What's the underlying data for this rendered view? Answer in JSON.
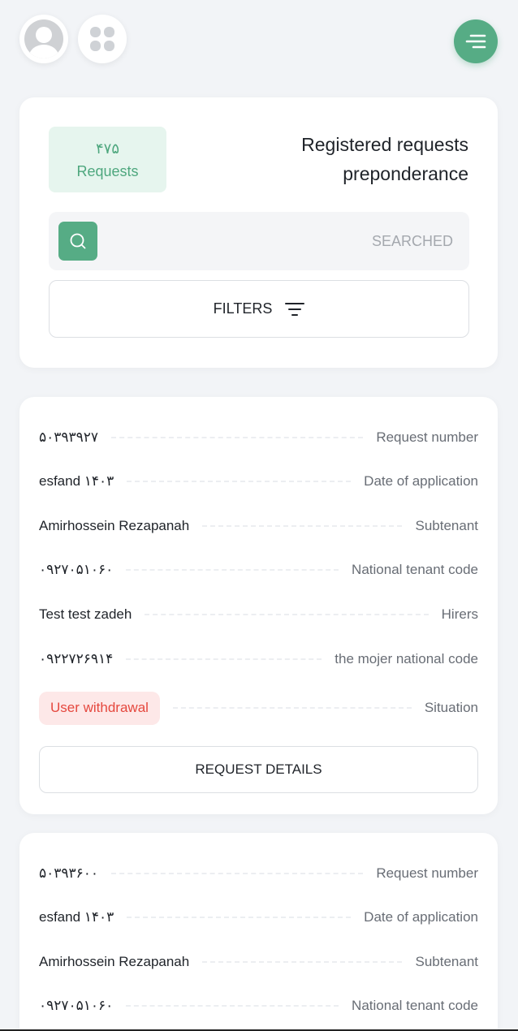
{
  "summary": {
    "count": "۴۷۵",
    "count_unit": "Requests",
    "title": "Registered requests preponderance",
    "search_placeholder": "SEARCHED",
    "filters_label": "FILTERS"
  },
  "requests": [
    {
      "rows": [
        {
          "label": "Request number",
          "value": "۵۰۳۹۳۹۲۷"
        },
        {
          "label": "Date of application",
          "value": "esfand ۱۴۰۳"
        },
        {
          "label": "Subtenant",
          "value": "Amirhossein Rezapanah"
        },
        {
          "label": "National tenant code",
          "value": "۰۹۲۷۰۵۱۰۶۰"
        },
        {
          "label": "Hirers",
          "value": "Test test zadeh"
        },
        {
          "label": "the mojer national code",
          "value": "۰۹۲۲۷۲۶۹۱۴"
        },
        {
          "label": "Situation",
          "value": "User withdrawal"
        }
      ],
      "details_label": "REQUEST DETAILS"
    },
    {
      "rows": [
        {
          "label": "Request number",
          "value": "۵۰۳۹۳۶۰۰"
        },
        {
          "label": "Date of application",
          "value": "esfand ۱۴۰۳"
        },
        {
          "label": "Subtenant",
          "value": "Amirhossein Rezapanah"
        },
        {
          "label": "National tenant code",
          "value": "۰۹۲۷۰۵۱۰۶۰"
        }
      ]
    }
  ],
  "colors": {
    "accent": "#56ac85",
    "accent_light": "#e6f5ee",
    "status_red": "#e5483e",
    "status_red_bg": "#fde8e8",
    "background": "#f2f4f7"
  },
  "icons": {
    "avatar": "user-avatar-icon",
    "apps": "apps-grid-icon",
    "menu": "menu-lines-icon",
    "search": "search-icon",
    "filter": "filter-icon"
  }
}
